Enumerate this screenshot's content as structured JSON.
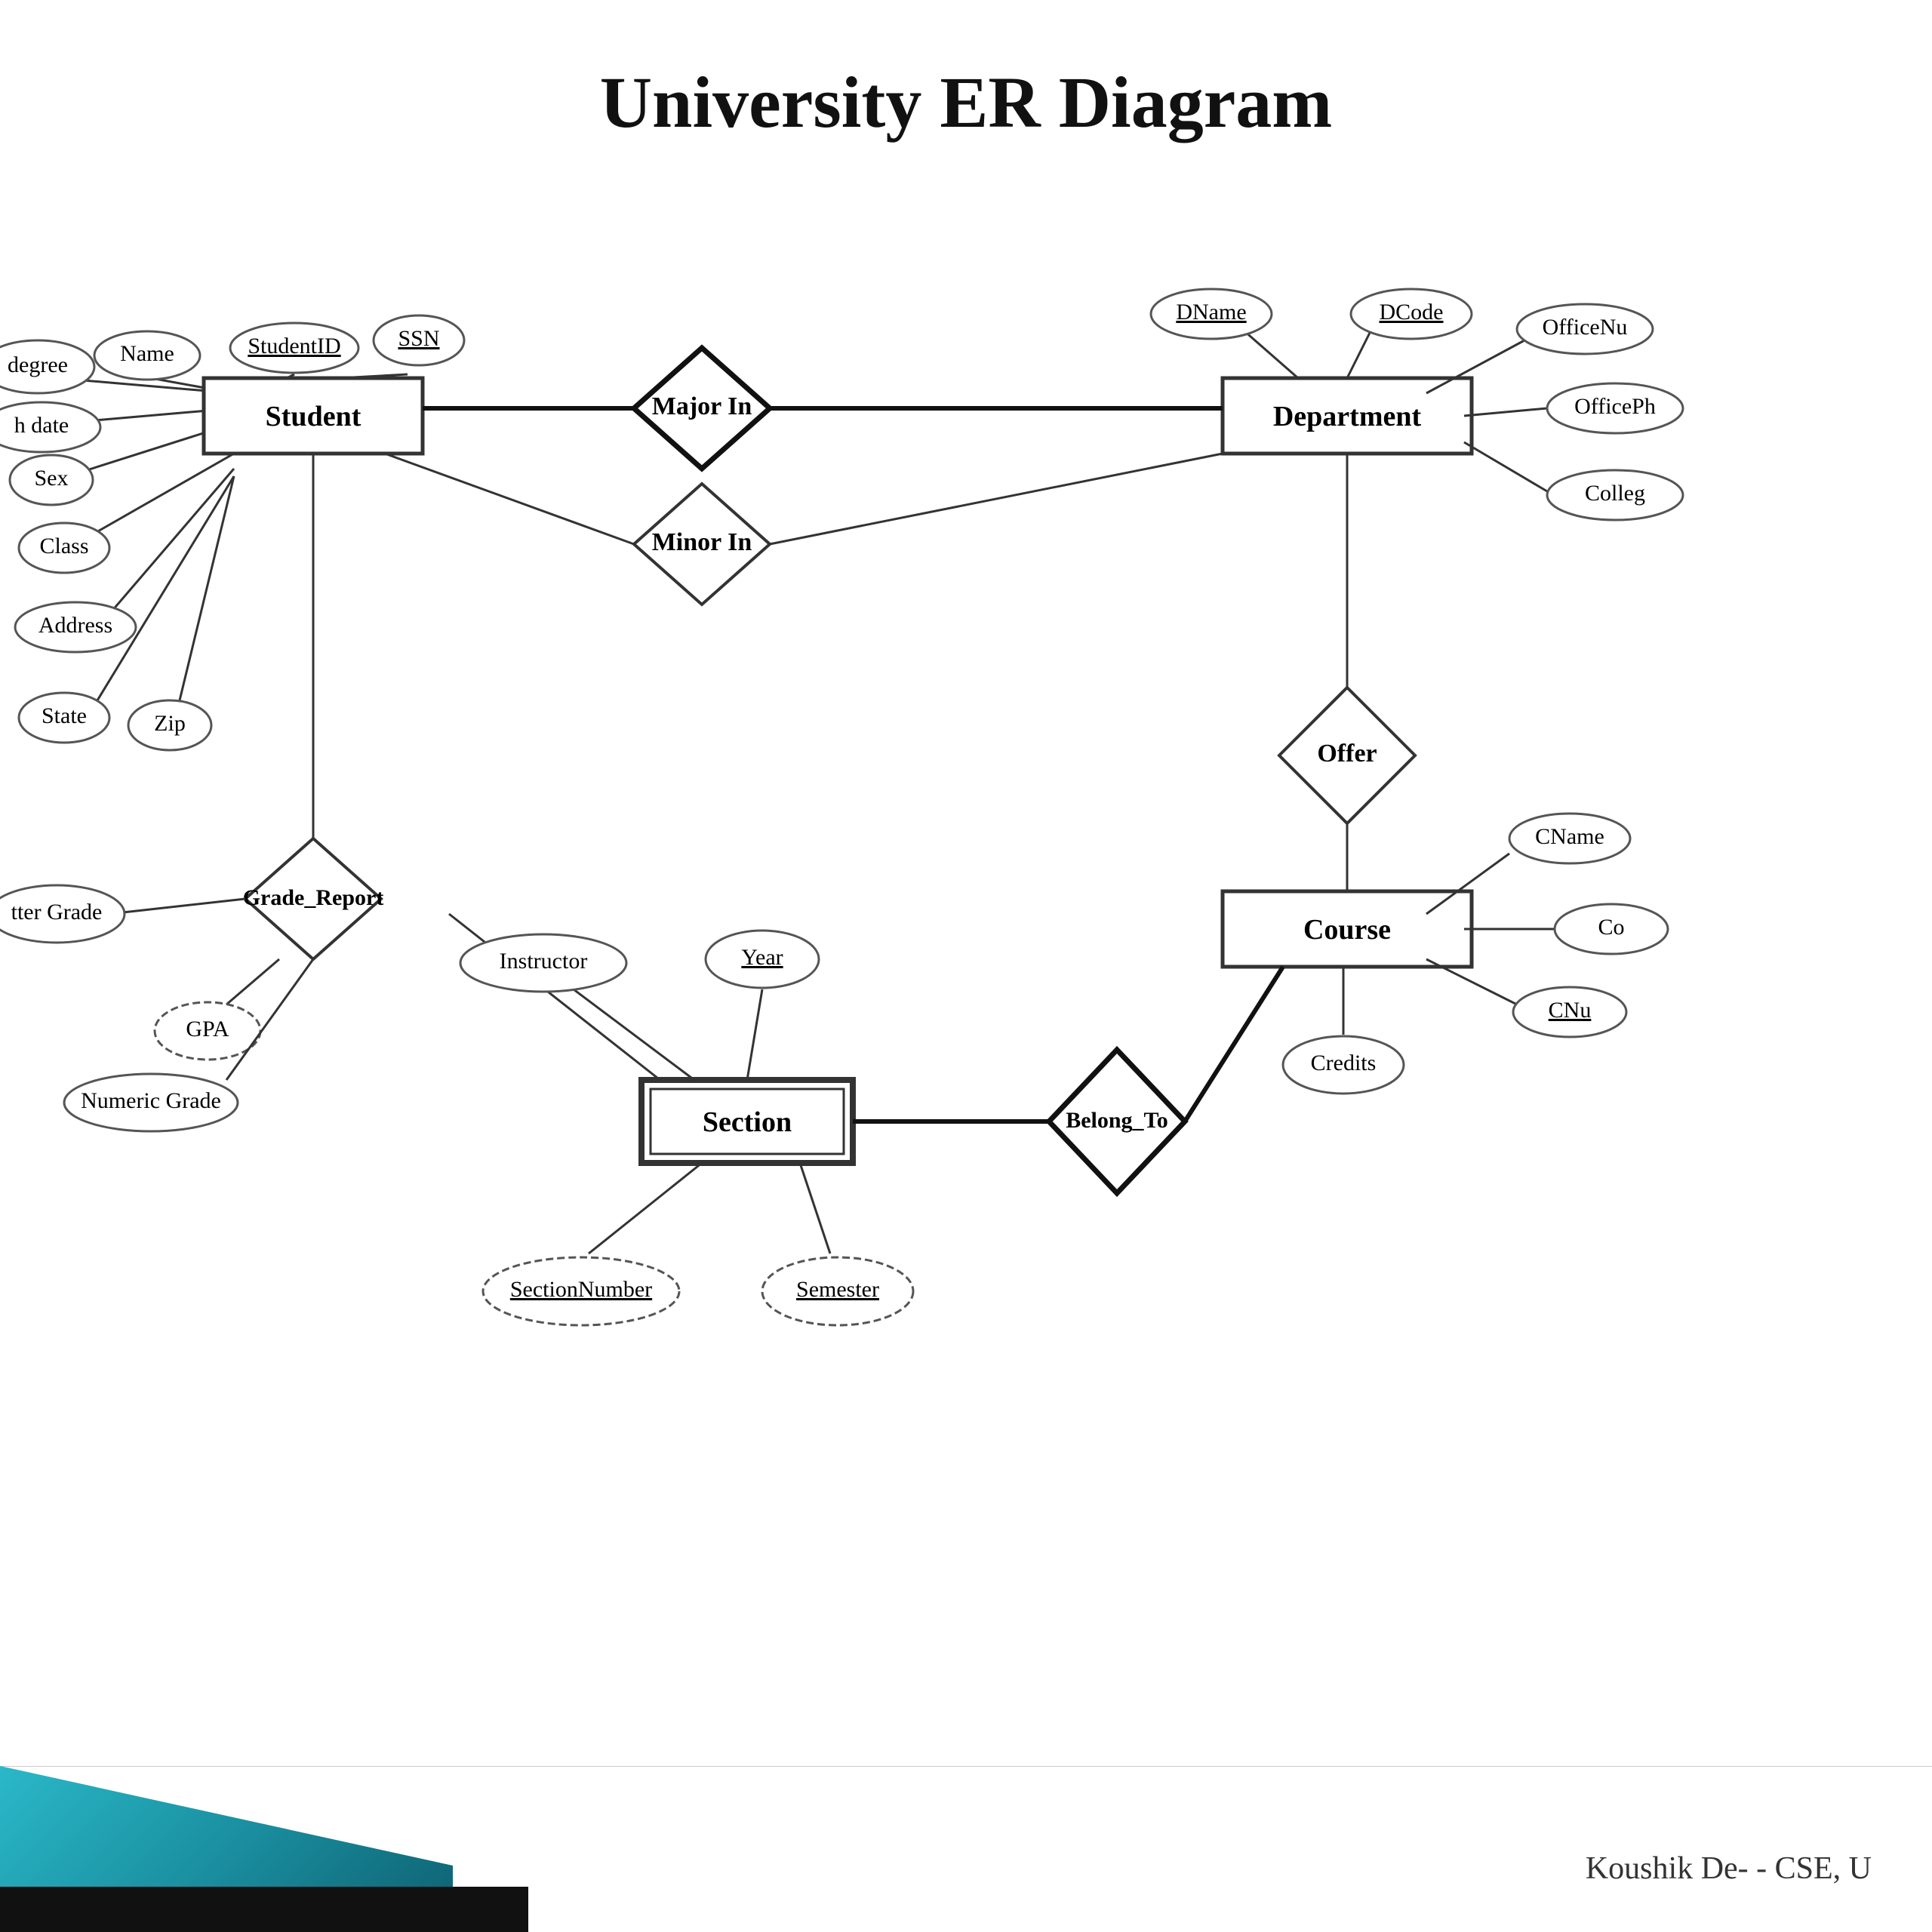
{
  "title": "University ER Diagram",
  "footer_credit": "Koushik De- - CSE, U",
  "entities": {
    "student": "Student",
    "department": "Department",
    "course": "Course",
    "section": "Section"
  },
  "relationships": {
    "major_in": "Major In",
    "minor_in": "Minor In",
    "offer": "Offer",
    "belong_to": "Belong_To",
    "grade_report": "Grade_Report"
  },
  "attributes": {
    "degree": "degree",
    "name": "Name",
    "student_id": "StudentID",
    "ssn": "SSN",
    "birth_date": "h date",
    "sex": "Sex",
    "class_attr": "Class",
    "address": "Address",
    "state": "State",
    "zip": "Zip",
    "dname": "DName",
    "dcode": "DCode",
    "office_num": "OfficeNu",
    "office_ph": "OfficePh",
    "college": "Colleg",
    "cname": "CName",
    "co": "Co",
    "cnum": "CNu",
    "credits": "Credits",
    "instructor": "Instructor",
    "year": "Year",
    "semester": "Semester",
    "section_number": "SectionNumber",
    "letter_grade": "tter Grade",
    "gpa": "GPA",
    "numeric_grade": "Numeric Grade"
  }
}
